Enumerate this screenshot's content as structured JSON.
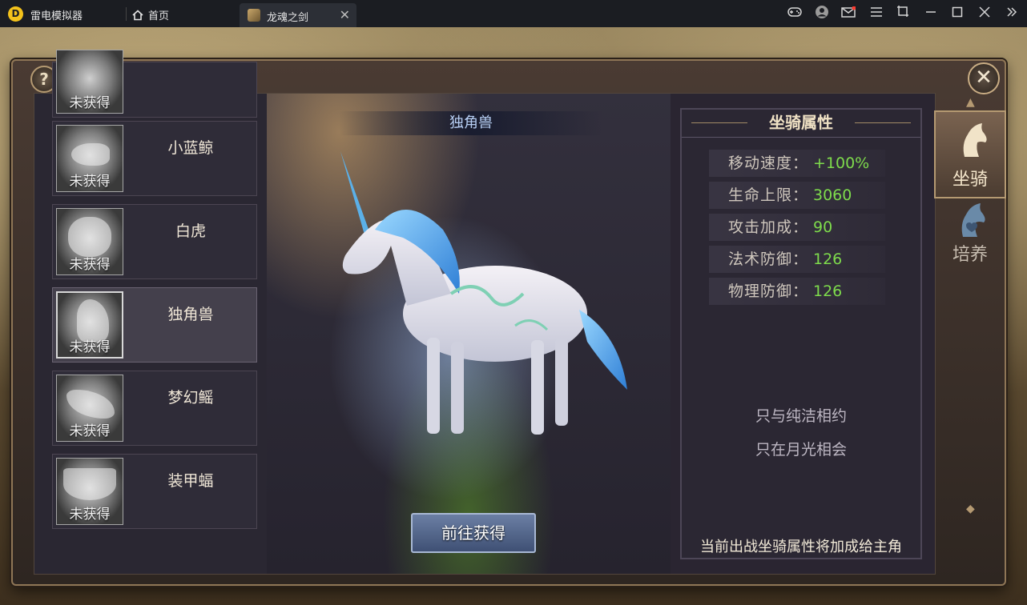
{
  "titlebar": {
    "app_name": "雷电模拟器",
    "home_label": "首页",
    "tab_label": "龙魂之剑",
    "tab_close": "✕",
    "logo_glyph": "D"
  },
  "panel": {
    "title": "坐骑",
    "help_glyph": "?",
    "close_glyph": "✕"
  },
  "mount_list": {
    "status_label": "未获得",
    "items": [
      {
        "name": "",
        "status": "未获得"
      },
      {
        "name": "小蓝鲸",
        "status": "未获得"
      },
      {
        "name": "白虎",
        "status": "未获得"
      },
      {
        "name": "独角兽",
        "status": "未获得"
      },
      {
        "name": "梦幻鳐",
        "status": "未获得"
      },
      {
        "name": "装甲蝠",
        "status": "未获得"
      }
    ],
    "selected_index": 3
  },
  "preview": {
    "mount_name": "独角兽",
    "goto_button": "前往获得"
  },
  "attributes": {
    "header": "坐骑属性",
    "rows": [
      {
        "label": "移动速度：",
        "value": "+100%"
      },
      {
        "label": "生命上限：",
        "value": "3060"
      },
      {
        "label": "攻击加成：",
        "value": "90"
      },
      {
        "label": "法术防御：",
        "value": "126"
      },
      {
        "label": "物理防御：",
        "value": "126"
      }
    ],
    "lore_lines": [
      "只与纯洁相约",
      "只在月光相会"
    ],
    "footer_note": "当前出战坐骑属性将加成给主角"
  },
  "side_tabs": [
    {
      "label": "坐骑",
      "icon": "horse-head-icon",
      "active": true
    },
    {
      "label": "培养",
      "icon": "horse-head-heart-icon",
      "active": false
    }
  ],
  "colors": {
    "attr_value": "#7edb4c",
    "accent_gold": "#b59a72",
    "button_blue": "#4f6188"
  }
}
